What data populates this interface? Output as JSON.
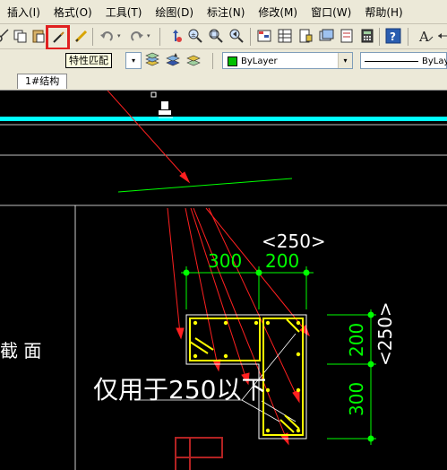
{
  "menu": {
    "items": [
      "插入(I)",
      "格式(O)",
      "工具(T)",
      "绘图(D)",
      "标注(N)",
      "修改(M)",
      "窗口(W)",
      "帮助(H)"
    ]
  },
  "tooltip": {
    "text": "特性匹配"
  },
  "layer_controls": {
    "color_value": "ByLayer",
    "linetype_value": "ByLay"
  },
  "tabs": {
    "drawing_tab": "1#结构"
  },
  "drawing": {
    "section_label": "截 面",
    "note_text": "仅用于250以下",
    "dim_total_top": "<250>",
    "dim_top_left": "300",
    "dim_top_right": "200",
    "dim_right_upper": "200",
    "dim_right_lower": "300",
    "dim_total_right": "<250>"
  },
  "colors": {
    "cad_background": "#000000",
    "highlight_line": "#00ffff",
    "dimension": "#00ff00",
    "rebar": "#ffff00",
    "arrow": "#ff0000",
    "outline": "#ffffff",
    "column_mark": "#b22222"
  }
}
